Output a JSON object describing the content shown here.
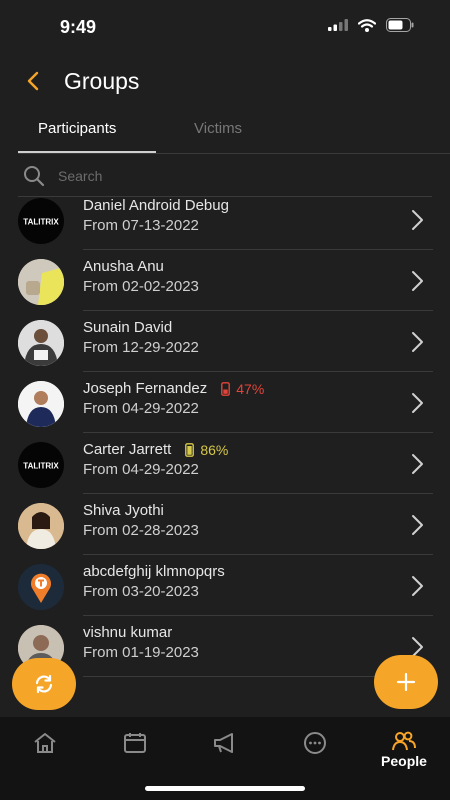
{
  "status_bar": {
    "time": "9:49"
  },
  "header": {
    "title": "Groups"
  },
  "tabs": [
    {
      "label": "Participants",
      "active": true
    },
    {
      "label": "Victims",
      "active": false
    }
  ],
  "search": {
    "placeholder": "Search",
    "value": ""
  },
  "participants": [
    {
      "name": "Daniel Android Debug",
      "from": "From 07-13-2022",
      "avatar": "talitrix-logo"
    },
    {
      "name": "Anusha Anu",
      "from": "From 02-02-2023",
      "avatar": "photo"
    },
    {
      "name": "Sunain David",
      "from": "From 12-29-2022",
      "avatar": "photo"
    },
    {
      "name": "Joseph Fernandez",
      "from": "From 04-29-2022",
      "avatar": "photo",
      "battery": "47%",
      "battery_color": "#e0443a"
    },
    {
      "name": "Carter Jarrett",
      "from": "From 04-29-2022",
      "avatar": "talitrix-logo",
      "battery": "86%",
      "battery_color": "#d6c84a"
    },
    {
      "name": "Shiva Jyothi",
      "from": "From 02-28-2023",
      "avatar": "photo"
    },
    {
      "name": "abcdefghij klmnopqrs",
      "from": "From 03-20-2023",
      "avatar": "location-pin-logo"
    },
    {
      "name": "vishnu kumar",
      "from": "From 01-19-2023",
      "avatar": "photo"
    }
  ],
  "logo_text": "TALITRIX",
  "bottom_nav": [
    {
      "icon": "home-icon",
      "label": ""
    },
    {
      "icon": "calendar-icon",
      "label": ""
    },
    {
      "icon": "megaphone-icon",
      "label": ""
    },
    {
      "icon": "chat-icon",
      "label": ""
    },
    {
      "icon": "people-icon",
      "label": "People",
      "active": true
    }
  ],
  "colors": {
    "accent": "#f5a528",
    "background": "#1f1f1f"
  }
}
